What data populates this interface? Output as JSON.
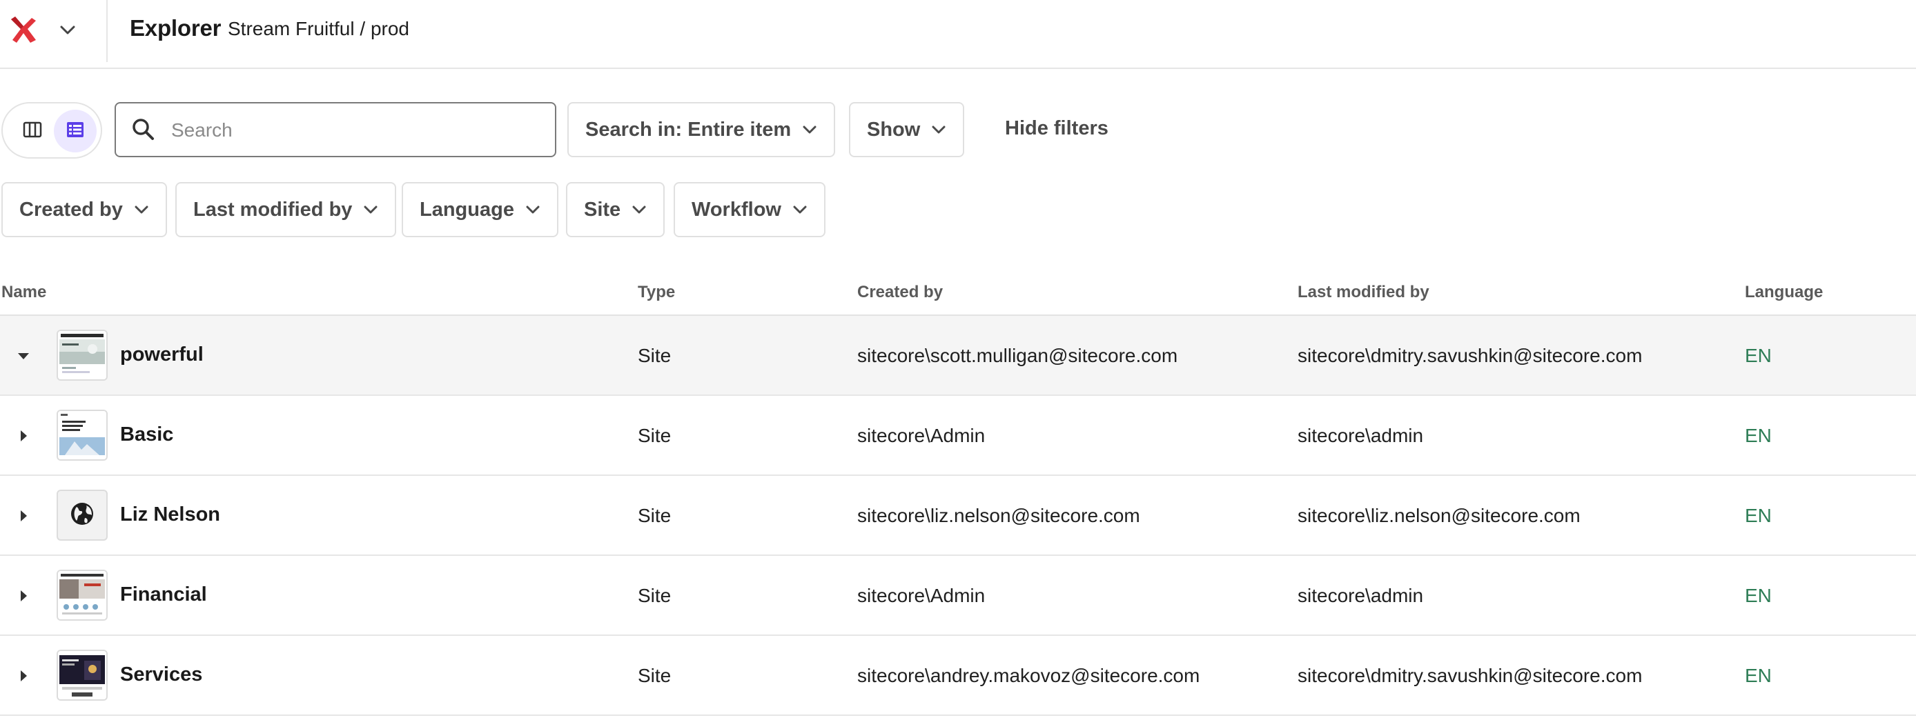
{
  "header": {
    "title": "Explorer",
    "breadcrumb": "Stream Fruitful / prod"
  },
  "toolbar": {
    "view_columns_icon": "columns-icon",
    "view_list_icon": "list-icon",
    "search_placeholder": "Search",
    "search_value": "",
    "search_in_label": "Search in: Entire item",
    "show_label": "Show",
    "hide_filters_label": "Hide filters"
  },
  "filters": {
    "created_by": "Created by",
    "last_modified_by": "Last modified by",
    "language": "Language",
    "site": "Site",
    "workflow": "Workflow"
  },
  "table": {
    "columns": {
      "name": "Name",
      "type": "Type",
      "created_by": "Created by",
      "last_modified_by": "Last modified by",
      "language": "Language"
    },
    "rows": [
      {
        "name": "powerful",
        "type": "Site",
        "created_by": "sitecore\\scott.mulligan@sitecore.com",
        "last_modified_by": "sitecore\\dmitry.savushkin@sitecore.com",
        "language": "EN",
        "expanded": true,
        "thumb": "landing-page-thumbnail"
      },
      {
        "name": "Basic",
        "type": "Site",
        "created_by": "sitecore\\Admin",
        "last_modified_by": "sitecore\\admin",
        "language": "EN",
        "expanded": false,
        "thumb": "basic-page-thumbnail"
      },
      {
        "name": "Liz Nelson",
        "type": "Site",
        "created_by": "sitecore\\liz.nelson@sitecore.com",
        "last_modified_by": "sitecore\\liz.nelson@sitecore.com",
        "language": "EN",
        "expanded": false,
        "thumb": "globe-icon"
      },
      {
        "name": "Financial",
        "type": "Site",
        "created_by": "sitecore\\Admin",
        "last_modified_by": "sitecore\\admin",
        "language": "EN",
        "expanded": false,
        "thumb": "financial-page-thumbnail"
      },
      {
        "name": "Services",
        "type": "Site",
        "created_by": "sitecore\\andrey.makovoz@sitecore.com",
        "last_modified_by": "sitecore\\dmitry.savushkin@sitecore.com",
        "language": "EN",
        "expanded": false,
        "thumb": "dark-page-thumbnail"
      }
    ]
  },
  "colors": {
    "accent": "#5b3ee8",
    "language": "#2e7d56",
    "logo": "#e2343c"
  }
}
